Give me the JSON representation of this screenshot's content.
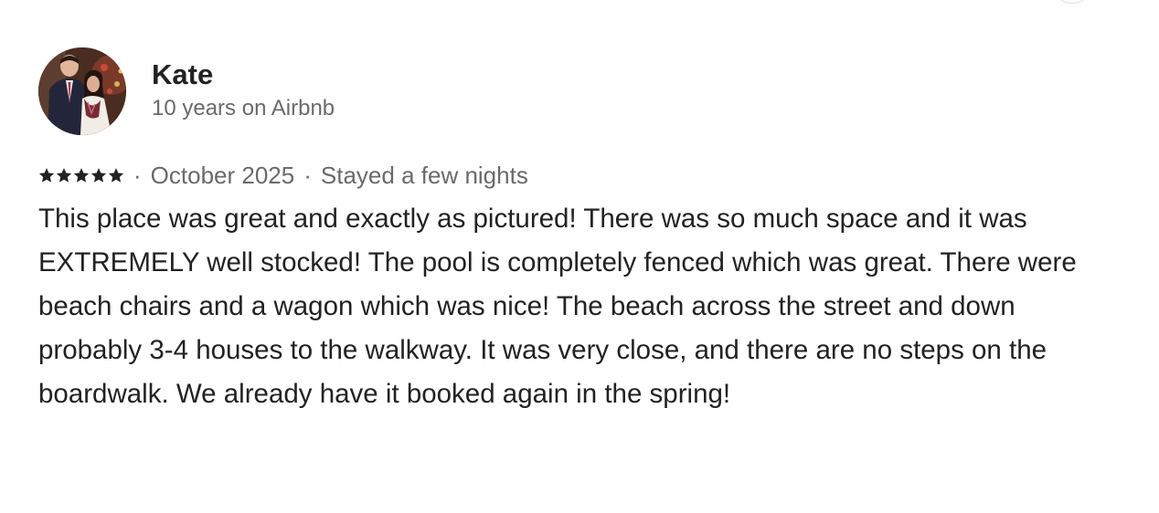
{
  "reviewer": {
    "name": "Kate",
    "tenure": "10 years on Airbnb",
    "avatar_icon": "user-photo-avatar"
  },
  "rating": {
    "stars": 5,
    "max": 5,
    "star_color": "#222222"
  },
  "stay": {
    "date": "October 2025",
    "separator": "·",
    "length": "Stayed a few nights"
  },
  "review": {
    "text": "This place was great and exactly as pictured! There was so much space and it was EXTREMELY well stocked! The pool is completely fenced which was great. There were beach chairs and a wagon which was nice! The beach across the street and down probably 3-4 houses to the walkway. It was very close, and there are no steps on the boardwalk. We already have it booked again in the spring!"
  },
  "colors": {
    "text_primary": "#222222",
    "text_secondary": "#6a6a6a",
    "border": "#dddddd"
  }
}
